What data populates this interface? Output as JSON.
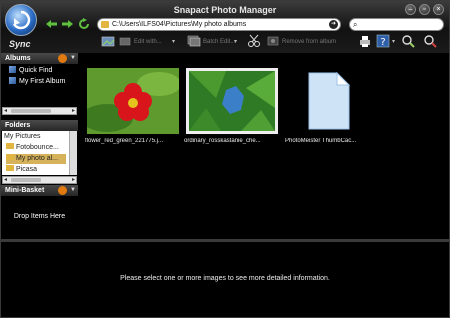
{
  "window": {
    "title": "Snapact Photo Manager",
    "sync_label": "Sync",
    "controls": [
      "minimize-icon",
      "maximize-icon",
      "close-icon"
    ]
  },
  "navigation": {
    "address_path": "C:\\Users\\ILFS04\\Pictures\\My photo albums",
    "search_placeholder": ""
  },
  "toolbar": {
    "edit_with_label": "Edit with...",
    "batch_edit_label": "Batch Edit...",
    "remove_from_album_label": "Remove from album"
  },
  "sidebar": {
    "albums_header": "Albums",
    "albums": [
      {
        "label": "Quick Find"
      },
      {
        "label": "My First Album"
      }
    ],
    "folders_header": "Folders",
    "folders": [
      {
        "label": "My Pictures"
      },
      {
        "label": "Fotobounce..."
      },
      {
        "label": "My photo al..."
      },
      {
        "label": "Picasa"
      }
    ],
    "mini_basket_header": "Mini-Basket",
    "mini_basket_text": "Drop Items Here"
  },
  "content": {
    "items": [
      {
        "label": "flower_red_green_221775.j...",
        "kind": "photo-red-flower"
      },
      {
        "label": "ordinary_rosskastanie_che...",
        "kind": "photo-green-leaves"
      },
      {
        "label": "PhotoMeister ThumbCac...",
        "kind": "document-file"
      }
    ]
  },
  "info_panel": {
    "message": "Please select one or more images to see more detailed information."
  },
  "colors": {
    "background": "#000000",
    "panel_header": "#3a3a3a",
    "accent_orange": "#e07a10",
    "folder_selected": "#d6b25a",
    "folder_icon": "#e2b440"
  }
}
